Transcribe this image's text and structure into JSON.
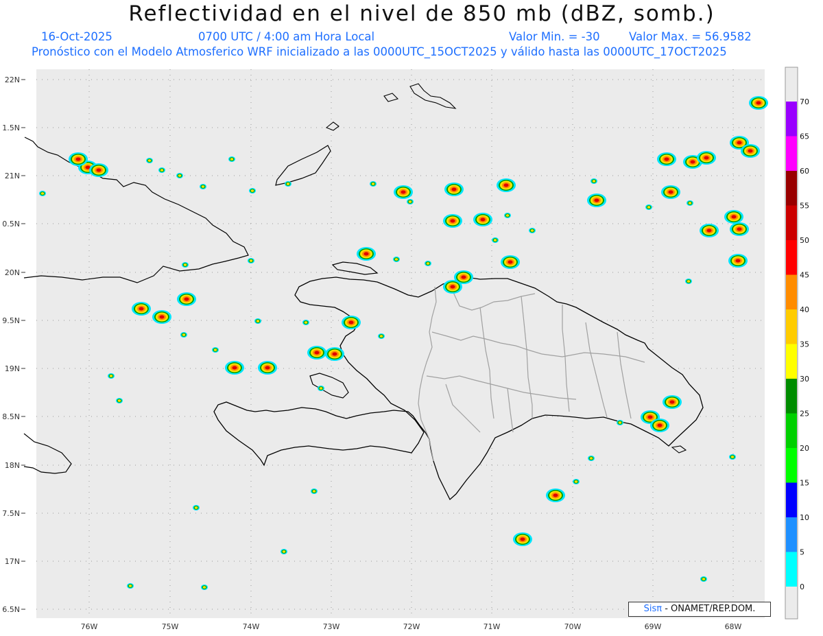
{
  "header": {
    "title": "Reflectividad en el nivel de 850 mb (dBZ, somb.)",
    "date": "16-Oct-2025",
    "time": "0700 UTC / 4:00 am Hora Local",
    "valmin": "Valor Min. = -30",
    "valmax": "Valor Max. = 56.9582",
    "model": "Pronóstico con el Modelo Atmosferico WRF inicializado a las 0000UTC_15OCT2025 y válido hasta las  0000UTC_17OCT2025"
  },
  "map": {
    "lat_labels": [
      "22N",
      "1.5N",
      "21N",
      "0.5N",
      "20N",
      "9.5N",
      "19N",
      "8.5N",
      "18N",
      "7.5N",
      "17N",
      "6.5N"
    ],
    "lon_labels": [
      "76W",
      "75W",
      "74W",
      "73W",
      "72W",
      "71W",
      "70W",
      "69W",
      "68W"
    ],
    "background": "#ebebeb",
    "coast_color": "#000000",
    "border_color": "#a0a0a0"
  },
  "colorbar": {
    "labels": [
      "0",
      "5",
      "10",
      "15",
      "20",
      "25",
      "30",
      "35",
      "40",
      "45",
      "50",
      "55",
      "60",
      "65",
      "70"
    ],
    "colors": [
      "#00ffff",
      "#1e90ff",
      "#0000ff",
      "#00ff00",
      "#00d000",
      "#008c00",
      "#ffff00",
      "#ffcc00",
      "#ff8c00",
      "#ff0000",
      "#cc0000",
      "#990000",
      "#ff00ff",
      "#9900ff"
    ]
  },
  "credit": {
    "sis": "Sisπ",
    "text": "- ONAMET/REP.DOM."
  }
}
